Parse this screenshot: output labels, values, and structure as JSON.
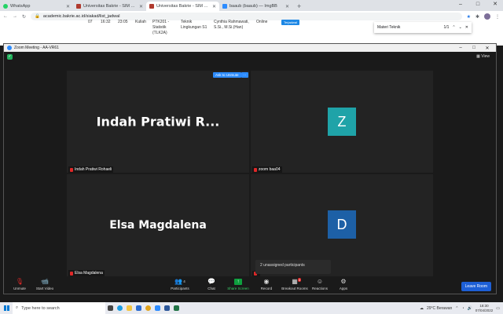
{
  "browser": {
    "tabs": [
      {
        "label": "WhatsApp",
        "color": "#25d366"
      },
      {
        "label": "Universitas Bakrie - SIM Akadem",
        "color": "#b03a2e"
      },
      {
        "label": "Universitas Bakrie - SIM Akadem",
        "color": "#b03a2e"
      },
      {
        "label": "baaub (baaub) — ImgBB",
        "color": "#2d8cff"
      }
    ],
    "new_tab": "+",
    "minimize": "–",
    "maximize": "□",
    "close": "✕",
    "url": "academic.bakrie.ac.id/siakad/list_jadwal",
    "find": {
      "query": "Materi Teknik",
      "count": "1/1",
      "prev": "⌃",
      "next": "⌄",
      "close": "✕"
    }
  },
  "webpage": {
    "row": {
      "num": "07",
      "time_start": "16:32",
      "time_end": "23:05",
      "room": "Kuliah",
      "course": "PTK201 - Statistik (TLK2A)",
      "subject": "Teknik Lingkungan S1",
      "lecturer": "Cynthia Rahmawati, S.Si., M.Si.(Han)",
      "mode": "Online",
      "badge": "Terjadwal"
    }
  },
  "zoom": {
    "title": "Zoom Meeting - AA-VR61",
    "view_label": "View",
    "participants": [
      {
        "display_name": "Indah Pratiwi R...",
        "label": "Indah Pratiwi Rohaeli",
        "initial": "",
        "color": ""
      },
      {
        "display_name": "",
        "label": "zoom baa04",
        "initial": "Z",
        "color": "#1fa3a8"
      },
      {
        "display_name": "Elsa Magdalena",
        "label": "Elsa Magdalena",
        "initial": "",
        "color": ""
      },
      {
        "display_name": "",
        "label": "",
        "initial": "D",
        "color": "#1d60a6"
      }
    ],
    "ask_to_unmute": "Ask to Unmute",
    "more": "···",
    "unassigned": "2 unassigned participants",
    "toolbar": {
      "unmute": "Unmute",
      "start_video": "Start Video",
      "participants": "Participants",
      "participants_count": "4",
      "chat": "Chat",
      "share_screen": "Share Screen",
      "record": "Record",
      "breakout_rooms": "Breakout Rooms",
      "breakout_badge": "3",
      "reactions": "Reactions",
      "apps": "Apps",
      "leave": "Leave Room"
    }
  },
  "taskbar": {
    "search_placeholder": "Type here to search",
    "weather": "29°C  Berawan",
    "time": "18:30",
    "date": "07/04/2022"
  }
}
